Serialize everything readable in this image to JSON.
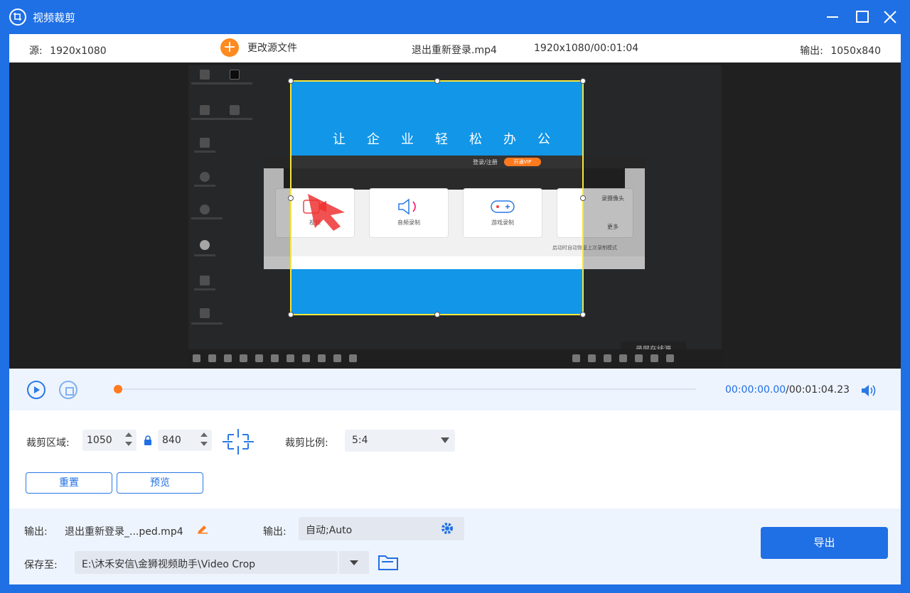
{
  "window": {
    "title": "视频裁剪",
    "icon": "crop-app-icon"
  },
  "infobar": {
    "source_label": "源:",
    "source_res": "1920x1080",
    "change_source": "更改源文件",
    "filename": "退出重新登录.mp4",
    "file_meta": "1920x1080/00:01:04",
    "output_label": "输出:",
    "output_res": "1050x840"
  },
  "video": {
    "slogan": "让企业轻松办公",
    "inner_login": "登录/注册",
    "inner_vip": "开通VIP",
    "cards": [
      "视频",
      "音频录制",
      "游戏录制"
    ],
    "side_items": [
      "录摄像头",
      "更多"
    ],
    "checkbox_text": "启动时自动恢复上次录制模式",
    "tray_tooltip": "录屏在线源"
  },
  "player": {
    "current_time": "00:00:00.00",
    "duration": "/00:01:04.23",
    "progress": 0
  },
  "crop": {
    "area_label": "裁剪区域:",
    "width": "1050",
    "height": "840",
    "ratio_label": "裁剪比例:",
    "ratio_value": "5:4",
    "reset": "重置",
    "preview": "预览"
  },
  "output": {
    "name_label": "输出:",
    "name_value": "退出重新登录_...ped.mp4",
    "format_label": "输出:",
    "format_value": "自动;Auto",
    "save_label": "保存至:",
    "save_path": "E:\\沐禾安信\\金狮视频助手\\Video Crop",
    "export": "导出"
  },
  "colors": {
    "accent": "#1f6fe5",
    "orange": "#ff8a1f",
    "crop_frame": "#f5e63a"
  }
}
